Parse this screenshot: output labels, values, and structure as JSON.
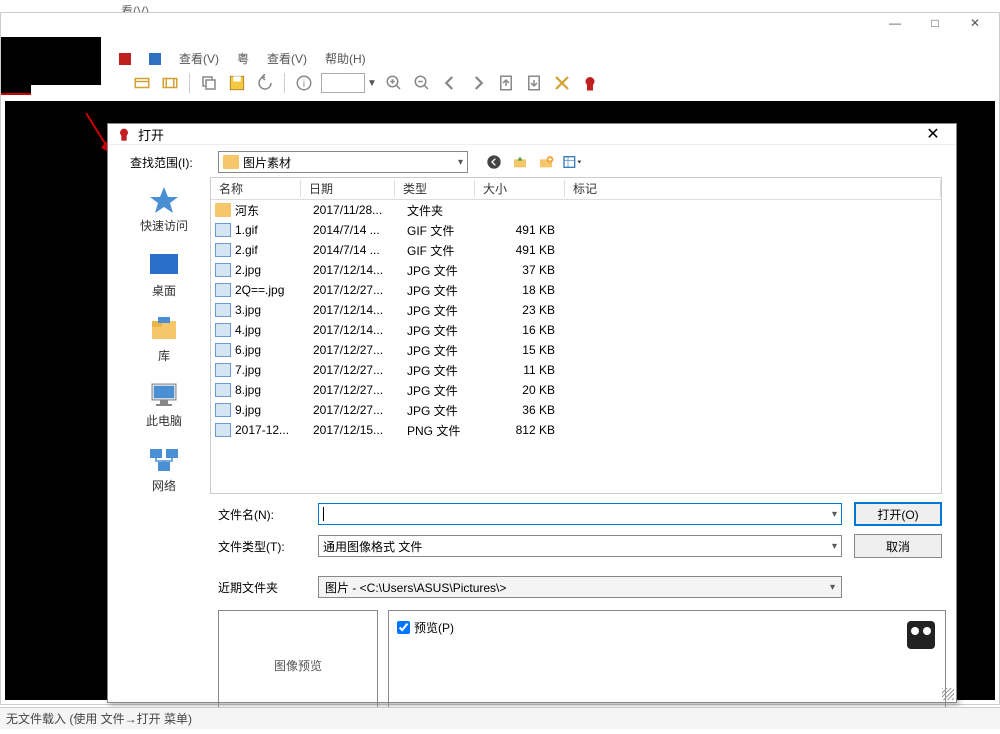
{
  "top_tab": "看(V)",
  "window": {
    "min": "—",
    "max": "□",
    "close": "✕"
  },
  "menu": {
    "view1": "查看(V)",
    "view2": "查看(V)",
    "help": "帮助(H)",
    "gou": "粤"
  },
  "dialog": {
    "title": "打开",
    "lookin_label": "查找范围(I):",
    "lookin_value": "图片素材",
    "columns": {
      "name": "名称",
      "date": "日期",
      "type": "类型",
      "size": "大小",
      "tag": "标记"
    },
    "files": [
      {
        "icon": "folder",
        "name": "河东",
        "date": "2017/11/28...",
        "type": "文件夹",
        "size": ""
      },
      {
        "icon": "img",
        "name": "1.gif",
        "date": "2014/7/14 ...",
        "type": "GIF 文件",
        "size": "491 KB"
      },
      {
        "icon": "img",
        "name": "2.gif",
        "date": "2014/7/14 ...",
        "type": "GIF 文件",
        "size": "491 KB"
      },
      {
        "icon": "img",
        "name": "2.jpg",
        "date": "2017/12/14...",
        "type": "JPG 文件",
        "size": "37 KB"
      },
      {
        "icon": "img",
        "name": "2Q==.jpg",
        "date": "2017/12/27...",
        "type": "JPG 文件",
        "size": "18 KB"
      },
      {
        "icon": "img",
        "name": "3.jpg",
        "date": "2017/12/14...",
        "type": "JPG 文件",
        "size": "23 KB"
      },
      {
        "icon": "img",
        "name": "4.jpg",
        "date": "2017/12/14...",
        "type": "JPG 文件",
        "size": "16 KB"
      },
      {
        "icon": "img",
        "name": "6.jpg",
        "date": "2017/12/27...",
        "type": "JPG 文件",
        "size": "15 KB"
      },
      {
        "icon": "img",
        "name": "7.jpg",
        "date": "2017/12/27...",
        "type": "JPG 文件",
        "size": "11 KB"
      },
      {
        "icon": "img",
        "name": "8.jpg",
        "date": "2017/12/27...",
        "type": "JPG 文件",
        "size": "20 KB"
      },
      {
        "icon": "img",
        "name": "9.jpg",
        "date": "2017/12/27...",
        "type": "JPG 文件",
        "size": "36 KB"
      },
      {
        "icon": "img",
        "name": "2017-12...",
        "date": "2017/12/15...",
        "type": "PNG 文件",
        "size": "812 KB"
      }
    ],
    "sidebar": [
      {
        "key": "quick",
        "label": "快速访问"
      },
      {
        "key": "desktop",
        "label": "桌面"
      },
      {
        "key": "lib",
        "label": "库"
      },
      {
        "key": "pc",
        "label": "此电脑"
      },
      {
        "key": "net",
        "label": "网络"
      }
    ],
    "filename_label": "文件名(N):",
    "filename_value": "",
    "filetype_label": "文件类型(T):",
    "filetype_value": "通用图像格式 文件",
    "recent_label": "近期文件夹",
    "recent_value": "图片  -  <C:\\Users\\ASUS\\Pictures\\>",
    "open_btn": "打开(O)",
    "cancel_btn": "取消",
    "preview_label": "图像预览",
    "preview_chk": "预览(P)"
  },
  "status": "无文件载入 (使用 文件→打开 菜单)"
}
